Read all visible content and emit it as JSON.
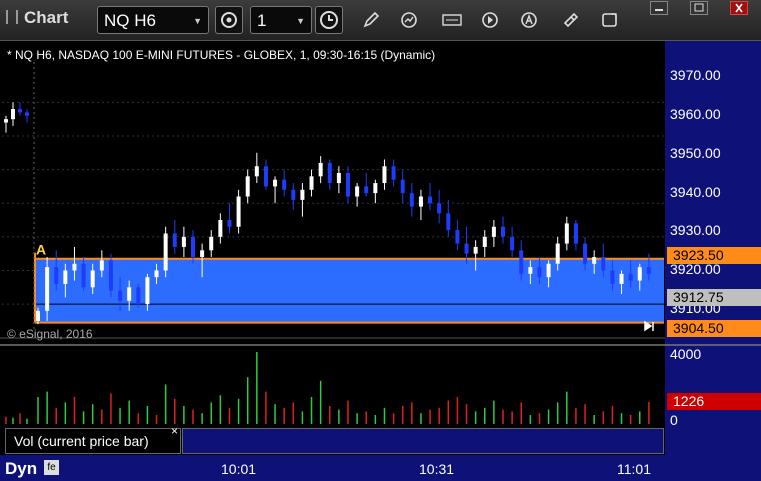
{
  "toolbar": {
    "app_title": "Chart",
    "symbol": "NQ H6",
    "interval": "1"
  },
  "chart": {
    "caption": "* NQ H6, NASDAQ 100 E-MINI FUTURES - GLOBEX, 1, 09:30-16:15 (Dynamic)",
    "copyright": "© eSignal, 2016",
    "marker_label": "A",
    "price_axis": [
      "3970.00",
      "3960.00",
      "3950.00",
      "3940.00",
      "3930.00",
      "3920.00",
      "3910.00"
    ],
    "range_high_tag": "3923.50",
    "range_low_tag": "3904.50",
    "current_price_tag": "3912.75",
    "volume_axis": [
      "4000",
      "0"
    ],
    "volume_tag": "1226",
    "volume_panel_label": "Vol (current price bar)",
    "volume_panel_close": "×",
    "time_axis": [
      "10:01",
      "10:31",
      "11:01"
    ],
    "bottom_label": "Dyn",
    "colors": {
      "range_fill": "#2c6cff",
      "range_border": "#ff8c1a",
      "up_candle": "#ffffff",
      "down_candle": "#1e3cff",
      "volume_up": "#2ecc40",
      "volume_down": "#e02020",
      "axis_panel": "#0e1278",
      "volume_tag": "#d00000"
    }
  },
  "chart_data": {
    "type": "candlestick",
    "y_range": [
      3902,
      3982
    ],
    "range_zone": {
      "high": 3923.5,
      "low": 3904.5
    },
    "current_price": 3912.75,
    "candles": [
      [
        3964,
        3966,
        3961,
        3965
      ],
      [
        3965,
        3970,
        3963,
        3968
      ],
      [
        3968,
        3970,
        3966,
        3967
      ],
      [
        3967,
        3968,
        3964,
        3966
      ],
      [
        3905,
        3909,
        3904,
        3908
      ],
      [
        3908,
        3924,
        3905,
        3921
      ],
      [
        3921,
        3926,
        3914,
        3916
      ],
      [
        3916,
        3922,
        3912,
        3920
      ],
      [
        3920,
        3927,
        3917,
        3922
      ],
      [
        3922,
        3924,
        3914,
        3915
      ],
      [
        3915,
        3922,
        3913,
        3920
      ],
      [
        3920,
        3926,
        3918,
        3923
      ],
      [
        3923,
        3925,
        3912,
        3914
      ],
      [
        3914,
        3918,
        3908,
        3911
      ],
      [
        3911,
        3917,
        3908,
        3915
      ],
      [
        3915,
        3916,
        3909,
        3910
      ],
      [
        3910,
        3919,
        3908,
        3918
      ],
      [
        3918,
        3922,
        3916,
        3920
      ],
      [
        3920,
        3933,
        3918,
        3931
      ],
      [
        3931,
        3935,
        3925,
        3927
      ],
      [
        3927,
        3933,
        3924,
        3930
      ],
      [
        3930,
        3932,
        3922,
        3924
      ],
      [
        3924,
        3928,
        3918,
        3926
      ],
      [
        3926,
        3932,
        3924,
        3930
      ],
      [
        3930,
        3937,
        3928,
        3935
      ],
      [
        3935,
        3940,
        3931,
        3933
      ],
      [
        3933,
        3944,
        3931,
        3942
      ],
      [
        3942,
        3950,
        3940,
        3948
      ],
      [
        3948,
        3955,
        3946,
        3951
      ],
      [
        3951,
        3953,
        3944,
        3945
      ],
      [
        3945,
        3948,
        3940,
        3947
      ],
      [
        3947,
        3950,
        3942,
        3944
      ],
      [
        3944,
        3946,
        3938,
        3941
      ],
      [
        3941,
        3946,
        3936,
        3944
      ],
      [
        3944,
        3950,
        3942,
        3948
      ],
      [
        3948,
        3954,
        3946,
        3952
      ],
      [
        3952,
        3953,
        3944,
        3946
      ],
      [
        3946,
        3951,
        3943,
        3949
      ],
      [
        3949,
        3951,
        3940,
        3942
      ],
      [
        3942,
        3946,
        3939,
        3945
      ],
      [
        3945,
        3949,
        3942,
        3943
      ],
      [
        3943,
        3947,
        3940,
        3946
      ],
      [
        3946,
        3953,
        3944,
        3951
      ],
      [
        3951,
        3953,
        3945,
        3947
      ],
      [
        3947,
        3950,
        3940,
        3943
      ],
      [
        3943,
        3946,
        3936,
        3939
      ],
      [
        3939,
        3944,
        3935,
        3942
      ],
      [
        3942,
        3946,
        3938,
        3940
      ],
      [
        3940,
        3944,
        3934,
        3937
      ],
      [
        3937,
        3941,
        3930,
        3932
      ],
      [
        3932,
        3935,
        3926,
        3928
      ],
      [
        3928,
        3933,
        3922,
        3925
      ],
      [
        3925,
        3929,
        3920,
        3927
      ],
      [
        3927,
        3932,
        3924,
        3930
      ],
      [
        3930,
        3935,
        3927,
        3933
      ],
      [
        3933,
        3936,
        3928,
        3930
      ],
      [
        3930,
        3933,
        3924,
        3926
      ],
      [
        3926,
        3929,
        3917,
        3919
      ],
      [
        3919,
        3923,
        3916,
        3921
      ],
      [
        3921,
        3924,
        3916,
        3918
      ],
      [
        3918,
        3923,
        3915,
        3922
      ],
      [
        3922,
        3930,
        3920,
        3928
      ],
      [
        3928,
        3936,
        3926,
        3934
      ],
      [
        3934,
        3935,
        3926,
        3928
      ],
      [
        3928,
        3930,
        3920,
        3922
      ],
      [
        3922,
        3926,
        3919,
        3924
      ],
      [
        3924,
        3928,
        3918,
        3920
      ],
      [
        3920,
        3923,
        3914,
        3916
      ],
      [
        3916,
        3920,
        3913,
        3919
      ],
      [
        3919,
        3923,
        3915,
        3917
      ],
      [
        3917,
        3922,
        3914,
        3921
      ],
      [
        3921,
        3925,
        3917,
        3919
      ]
    ],
    "volume": [
      [
        400,
        "down"
      ],
      [
        350,
        "up"
      ],
      [
        600,
        "down"
      ],
      [
        300,
        "up"
      ],
      [
        1500,
        "up"
      ],
      [
        1800,
        "up"
      ],
      [
        900,
        "down"
      ],
      [
        1200,
        "up"
      ],
      [
        1500,
        "down"
      ],
      [
        700,
        "up"
      ],
      [
        1100,
        "up"
      ],
      [
        800,
        "down"
      ],
      [
        1700,
        "down"
      ],
      [
        900,
        "up"
      ],
      [
        1300,
        "up"
      ],
      [
        600,
        "down"
      ],
      [
        1000,
        "up"
      ],
      [
        500,
        "down"
      ],
      [
        2200,
        "up"
      ],
      [
        1400,
        "down"
      ],
      [
        1000,
        "up"
      ],
      [
        800,
        "down"
      ],
      [
        600,
        "up"
      ],
      [
        1200,
        "up"
      ],
      [
        1600,
        "up"
      ],
      [
        900,
        "down"
      ],
      [
        1400,
        "up"
      ],
      [
        2600,
        "up"
      ],
      [
        4000,
        "up"
      ],
      [
        1800,
        "down"
      ],
      [
        1100,
        "up"
      ],
      [
        900,
        "down"
      ],
      [
        1200,
        "down"
      ],
      [
        700,
        "up"
      ],
      [
        1500,
        "up"
      ],
      [
        2400,
        "up"
      ],
      [
        1000,
        "down"
      ],
      [
        800,
        "up"
      ],
      [
        1300,
        "down"
      ],
      [
        600,
        "up"
      ],
      [
        700,
        "down"
      ],
      [
        500,
        "up"
      ],
      [
        900,
        "up"
      ],
      [
        600,
        "down"
      ],
      [
        1000,
        "down"
      ],
      [
        1200,
        "down"
      ],
      [
        600,
        "up"
      ],
      [
        800,
        "down"
      ],
      [
        900,
        "down"
      ],
      [
        1300,
        "down"
      ],
      [
        1500,
        "down"
      ],
      [
        1100,
        "down"
      ],
      [
        700,
        "up"
      ],
      [
        900,
        "up"
      ],
      [
        1300,
        "up"
      ],
      [
        800,
        "down"
      ],
      [
        700,
        "down"
      ],
      [
        1200,
        "down"
      ],
      [
        500,
        "up"
      ],
      [
        600,
        "down"
      ],
      [
        800,
        "up"
      ],
      [
        1200,
        "up"
      ],
      [
        1800,
        "up"
      ],
      [
        900,
        "down"
      ],
      [
        1100,
        "down"
      ],
      [
        500,
        "up"
      ],
      [
        700,
        "down"
      ],
      [
        1000,
        "down"
      ],
      [
        600,
        "up"
      ],
      [
        500,
        "down"
      ],
      [
        700,
        "up"
      ],
      [
        1226,
        "down"
      ]
    ]
  }
}
